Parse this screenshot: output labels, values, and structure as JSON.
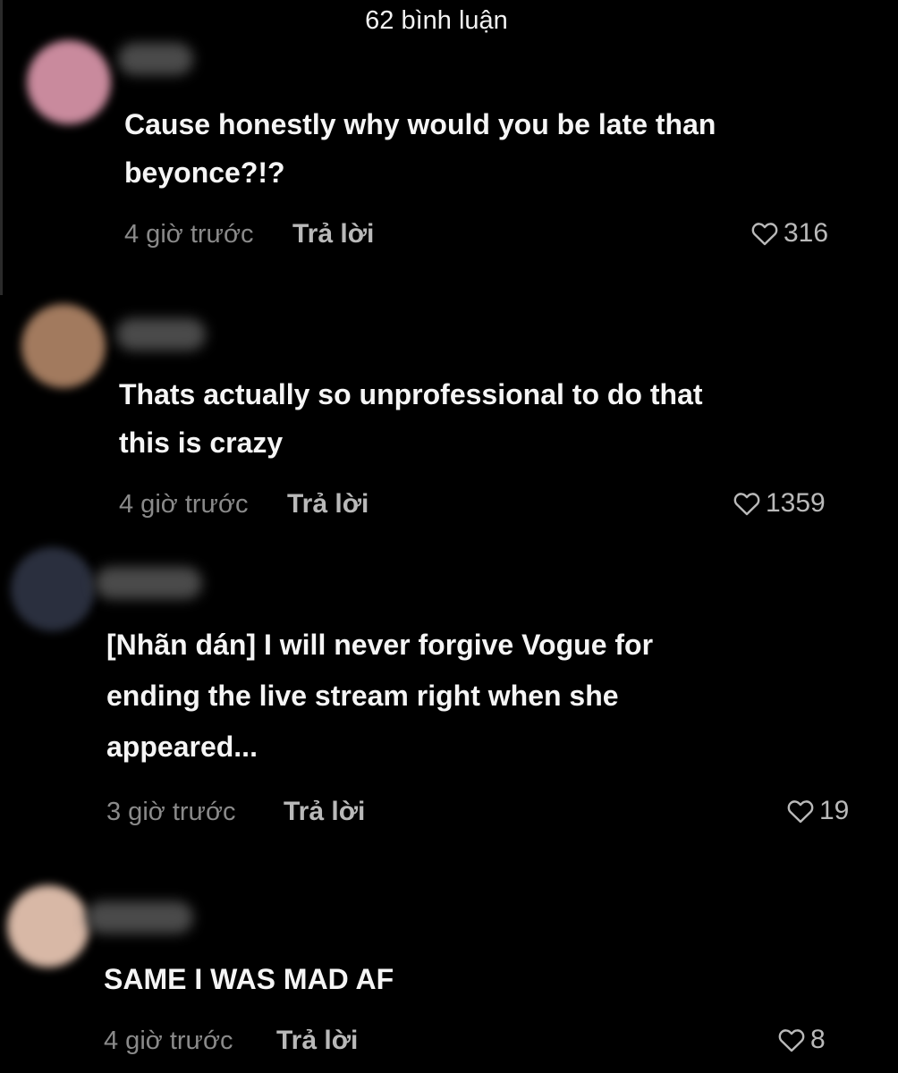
{
  "header": {
    "title": "62 bình luận"
  },
  "comments": [
    {
      "avatar_color": "#c98a9d",
      "lines": [
        "Cause honestly why would you be late than",
        "beyonce?!?"
      ],
      "time": "4 giờ trước",
      "reply_label": "Trả lời",
      "likes": "316"
    },
    {
      "avatar_color": "#a27a5e",
      "lines": [
        "Thats actually so unprofessional to do that",
        "this is crazy"
      ],
      "time": "4 giờ trước",
      "reply_label": "Trả lời",
      "likes": "1359"
    },
    {
      "avatar_color": "#2a2f3e",
      "lines": [
        "[Nhãn dán] I will never forgive Vogue for",
        "ending the live stream right when she",
        "appeared..."
      ],
      "time": "3 giờ trước",
      "reply_label": "Trả lời",
      "likes": "19"
    },
    {
      "avatar_color": "#d8b8a6",
      "lines": [
        "SAME I WAS MAD AF"
      ],
      "time": "4 giờ trước",
      "reply_label": "Trả lời",
      "likes": "8"
    }
  ],
  "icons": {
    "like": "heart-outline-icon"
  }
}
